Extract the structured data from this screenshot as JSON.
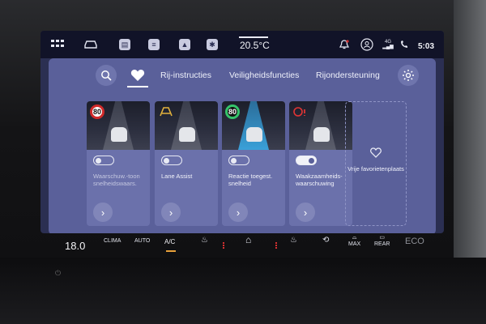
{
  "statusbar": {
    "apps_icon": "grid-icon",
    "car_icon": "car-icon",
    "temperature": "20.5°C",
    "network": "4G",
    "time": "5:03"
  },
  "tabs": {
    "labels": [
      "Rij-instructies",
      "Veiligheidsfuncties",
      "Rijondersteuning"
    ]
  },
  "cards": [
    {
      "label": "Waarschuw.-toon snelheidswaars.",
      "enabled": false,
      "sign": "80"
    },
    {
      "label": "Lane Assist",
      "enabled": false,
      "sign": ""
    },
    {
      "label": "Reactie toegest. snelheid",
      "enabled": false,
      "sign": "80"
    },
    {
      "label": "Waakzaamheids-waarschuwing",
      "enabled": true,
      "sign": ""
    }
  ],
  "favorite_slot": {
    "label": "Vrije favorietenplaats"
  },
  "climate": {
    "temperature": "18.0",
    "clima": "CLIMA",
    "auto": "AUTO",
    "ac": "A/C",
    "max": "MAX",
    "rear": "REAR",
    "eco": "ECO"
  },
  "colors": {
    "content_bg": "#5a609a",
    "card_bg": "#6b71ab",
    "statusbar_bg": "#111328",
    "ac_accent": "#e8a13a",
    "warning_red": "#d02a2a"
  }
}
